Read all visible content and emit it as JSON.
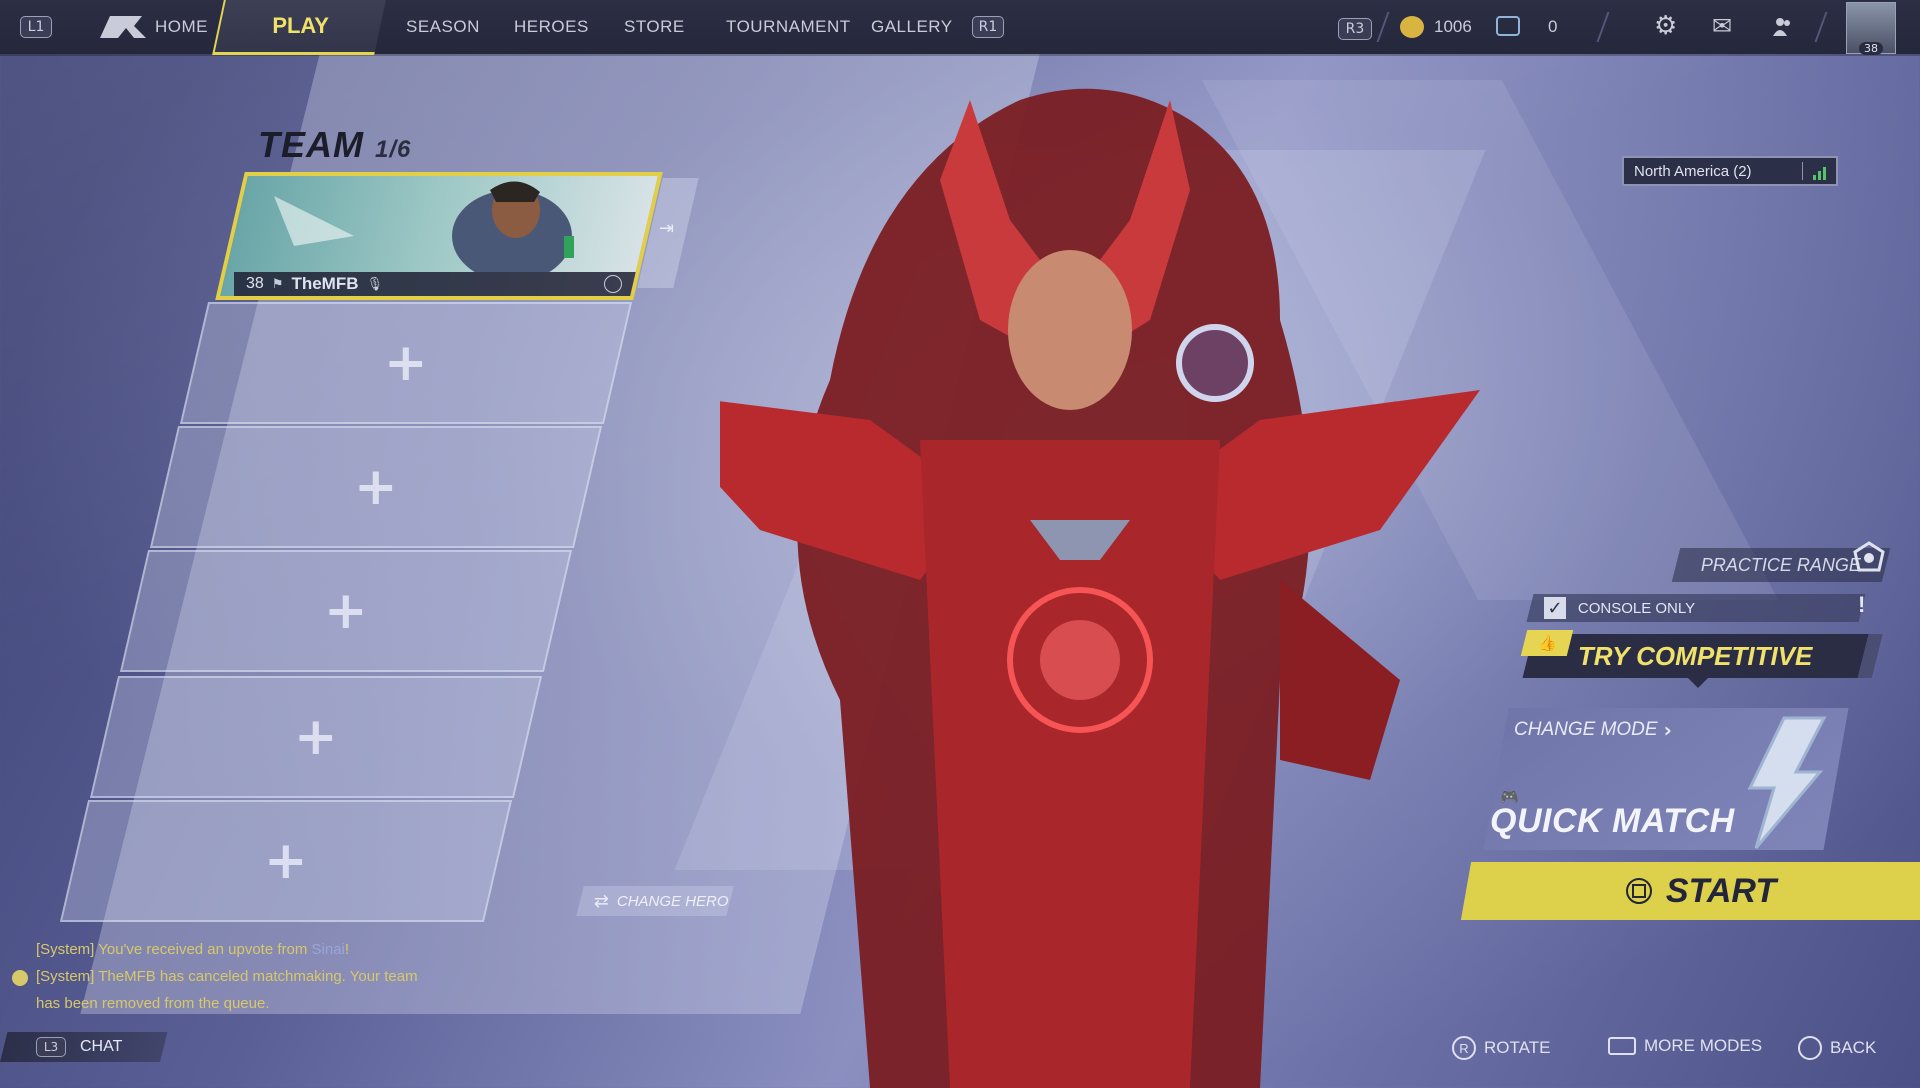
{
  "topbar": {
    "left_hint": "L1",
    "right_hint": "R1",
    "nav": [
      "HOME",
      "PLAY",
      "SEASON",
      "HEROES",
      "STORE",
      "TOURNAMENT",
      "GALLERY"
    ],
    "r3_hint": "R3",
    "currency_value": "1006",
    "tokens_value": "0",
    "avatar_level": "38",
    "icons": [
      "gear-icon",
      "mail-icon",
      "friends-icon"
    ]
  },
  "team": {
    "title": "TEAM",
    "count": "1/6",
    "player": {
      "level": "38",
      "name": "TheMFB"
    },
    "empty_slots": [
      "+",
      "+",
      "+",
      "+",
      "+"
    ],
    "change_hero": "CHANGE HERO"
  },
  "region": {
    "label": "North America (2)"
  },
  "play_panel": {
    "practice_range": "PRACTICE RANGE",
    "console_only": "CONSOLE ONLY",
    "console_only_checked": true,
    "alert": "!",
    "try_competitive": "TRY COMPETITIVE",
    "change_mode": "CHANGE MODE",
    "mode_name": "QUICK MATCH",
    "start": "START"
  },
  "chat": {
    "lines": [
      {
        "prefix": "[System] You've received an upvote from ",
        "name": "Sinai",
        "suffix": "!"
      },
      {
        "text": "[System] TheMFB has canceled matchmaking. Your team"
      },
      {
        "text": "has been removed from the queue."
      }
    ],
    "button_hint": "L3",
    "button_label": "CHAT"
  },
  "bottom_hints": {
    "rotate": "ROTATE",
    "rotate_key": "R",
    "more_modes": "MORE MODES",
    "back": "BACK"
  },
  "colors": {
    "accent_yellow": "#e2cf45",
    "topbar": "#2a2c42",
    "chat_text": "#d7c86a"
  }
}
